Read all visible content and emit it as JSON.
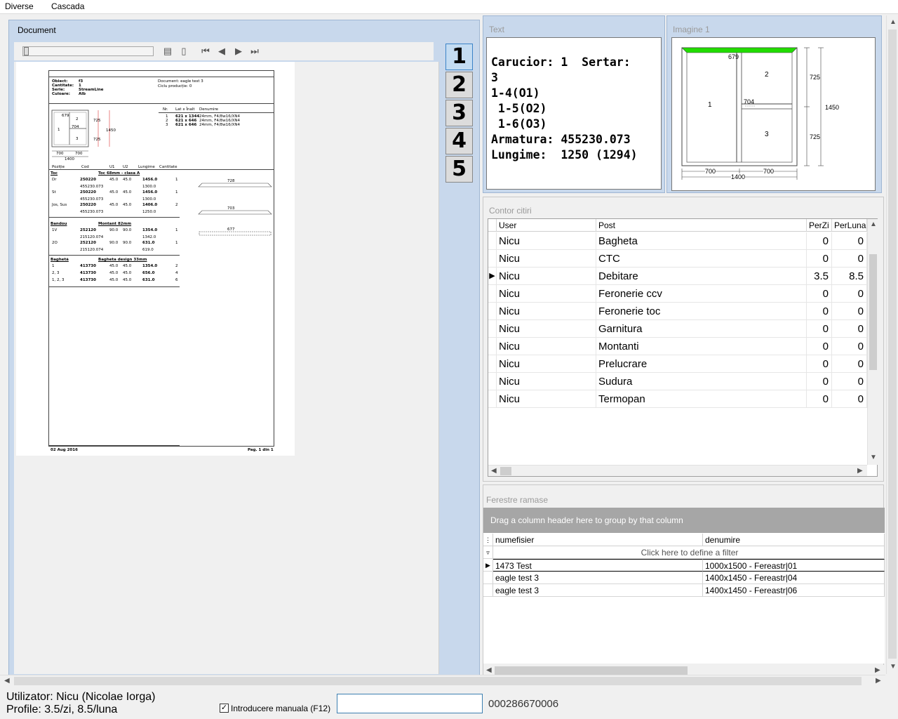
{
  "menu": {
    "items": [
      "Diverse",
      "Cascada"
    ]
  },
  "document_panel": {
    "title": "Document",
    "page_buttons": [
      "1",
      "2",
      "3",
      "4",
      "5"
    ],
    "page": {
      "obiect_label": "Obiect:",
      "obiect": "f3",
      "cantitate_label": "Cantitate:",
      "cantitate": "1",
      "serie_label": "Serie:",
      "serie": "StreamLine",
      "culoare_label": "Culoare:",
      "culoare": "Alb",
      "document_label": "Document: eagle test 3",
      "ciclu": "Ciclu producție: 0",
      "glass_header": [
        "Nr.",
        "Lat x Înalt",
        "Denumire"
      ],
      "glass_rows": [
        [
          "1",
          "621 x 1344",
          "24mm, F4/8w16/XN4"
        ],
        [
          "2",
          "621 x 646",
          "24mm, F4/8w16/XN4"
        ],
        [
          "3",
          "621 x 646",
          "24mm, F4/8w16/XN4"
        ]
      ],
      "dims": {
        "d679": "679",
        "d725a": "725",
        "d725b": "725",
        "d1450": "1450",
        "d704": "704",
        "d700a": "700",
        "d700b": "700",
        "d1400": "1400",
        "s1": "1",
        "s2": "2",
        "s3": "3"
      },
      "table_header": [
        "Poziție",
        "Cod",
        "U1",
        "U2",
        "Lungime",
        "Cantitate"
      ],
      "sections": [
        {
          "name": "Toc",
          "desc": "Toc 68mm - clasa A",
          "rows": [
            [
              "Dr",
              "250220",
              "45.0",
              "45.0",
              "1456.0",
              "1"
            ],
            [
              "",
              "455230.073",
              "",
              "",
              "1300.0",
              ""
            ],
            [
              "St",
              "250220",
              "45.0",
              "45.0",
              "1456.0",
              "1"
            ],
            [
              "",
              "455230.073",
              "",
              "",
              "1300.0",
              ""
            ],
            [
              "Jos, Sus",
              "250220",
              "45.0",
              "45.0",
              "1406.0",
              "2"
            ],
            [
              "",
              "455230.073",
              "",
              "",
              "1250.0",
              ""
            ]
          ],
          "bar_labels": [
            "728",
            "703"
          ]
        },
        {
          "name": "Bandou",
          "desc": "Montant 82mm",
          "rows": [
            [
              "1V",
              "252120",
              "90.0",
              "90.0",
              "1354.0",
              "1"
            ],
            [
              "",
              "215120.074",
              "",
              "",
              "1342.0",
              ""
            ],
            [
              "2O",
              "252120",
              "90.0",
              "90.0",
              "631.0",
              "1"
            ],
            [
              "",
              "215120.074",
              "",
              "",
              "619.0",
              ""
            ]
          ],
          "bar_labels": [
            "677"
          ]
        },
        {
          "name": "Baghetă",
          "desc": "Bagheta design 33mm",
          "rows": [
            [
              "1",
              "413730",
              "45.0",
              "45.0",
              "1354.0",
              "2"
            ],
            [
              "2, 3",
              "413730",
              "45.0",
              "45.0",
              "656.0",
              "4"
            ],
            [
              "1, 2, 3",
              "413730",
              "45.0",
              "45.0",
              "631.0",
              "6"
            ]
          ]
        }
      ],
      "footer_date": "02 Aug 2016",
      "footer_page": "Pag. 1 din 1"
    }
  },
  "text_panel": {
    "title": "Text",
    "content": "Carucior: 1  Sertar:\n3\n1-4(O1)\n 1-5(O2)\n 1-6(O3)\nArmatura: 455230.073\nLungime:  1250 (1294)"
  },
  "image_panel": {
    "title": "Imagine 1",
    "labels": {
      "d679": "679",
      "d725a": "725",
      "d725b": "725",
      "d1450": "1450",
      "d704": "704",
      "d700a": "700",
      "d700b": "700",
      "d1400": "1400",
      "s1": "1",
      "s2": "2",
      "s3": "3"
    },
    "top_bar_color": "#22dd00"
  },
  "contor_panel": {
    "title": "Contor citiri",
    "columns": [
      "User",
      "Post",
      "PerZi",
      "PerLuna"
    ],
    "rows": [
      [
        "Nicu",
        "Bagheta",
        "0",
        "0"
      ],
      [
        "Nicu",
        "CTC",
        "0",
        "0"
      ],
      [
        "Nicu",
        "Debitare",
        "3.5",
        "8.5"
      ],
      [
        "Nicu",
        "Feronerie ccv",
        "0",
        "0"
      ],
      [
        "Nicu",
        "Feronerie toc",
        "0",
        "0"
      ],
      [
        "Nicu",
        "Garnitura",
        "0",
        "0"
      ],
      [
        "Nicu",
        "Montanti",
        "0",
        "0"
      ],
      [
        "Nicu",
        "Prelucrare",
        "0",
        "0"
      ],
      [
        "Nicu",
        "Sudura",
        "0",
        "0"
      ],
      [
        "Nicu",
        "Termopan",
        "0",
        "0"
      ]
    ],
    "current_row": 2
  },
  "ferestre_panel": {
    "title": "Ferestre ramase",
    "group_hint": "Drag a column header here to group by that column",
    "filter_hint": "Click here to define a filter",
    "columns": [
      "numefisier",
      "denumire"
    ],
    "rows": [
      [
        "1473 Test",
        "1000x1500 - Fereastr|01"
      ],
      [
        "eagle test 3",
        "1400x1450 - Fereastr|04"
      ],
      [
        "eagle test 3",
        "1400x1450 - Fereastr|06"
      ]
    ]
  },
  "status": {
    "user": "Utilizator: Nicu (Nicolae Iorga)",
    "profile": "Profile: 3.5/zi, 8.5/luna",
    "manual_label": "Introducere manuala (F12)",
    "manual_checked": true,
    "input_value": "",
    "code": "000286670006"
  }
}
